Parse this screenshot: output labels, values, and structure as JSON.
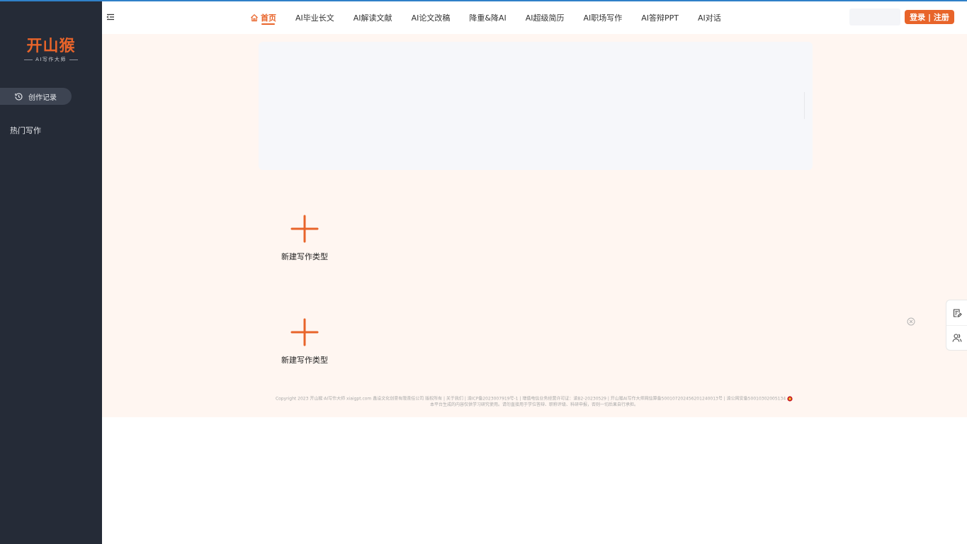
{
  "brand": {
    "logo_main": "开山猴",
    "logo_sub": "AI写作大师"
  },
  "sidebar": {
    "history_label": "创作记录",
    "hot_label": "热门写作"
  },
  "nav": {
    "items": [
      {
        "label": "首页",
        "active": true
      },
      {
        "label": "AI毕业长文"
      },
      {
        "label": "AI解读文献"
      },
      {
        "label": "AI论文改稿"
      },
      {
        "label": "降重&降AI"
      },
      {
        "label": "AI超级简历"
      },
      {
        "label": "AI职场写作"
      },
      {
        "label": "AI答辩PPT"
      },
      {
        "label": "AI对话"
      }
    ]
  },
  "header": {
    "auth_label": "登录 | 注册"
  },
  "cards": [
    {
      "label": "新建写作类型"
    },
    {
      "label": "新建写作类型"
    }
  ],
  "footer": {
    "line1": "Copyright 2023 开山猴·AI写作大师 xiaigpt.com 鑫设文化创意有限责任公司 版权所有 | 关于我们 | 渝ICP备2023007919号-1 | 增值电信业务经营许可证：渝B2-20230529 | 开山猴AI写作大师网信算备500107202456201240013号 | 渝公网安备50010302005134",
    "line2": "本平台生成的内容仅供学习研究使用。请勿直接用于学位答辩、职称评级、科研申报，否则一切后果自行承担。"
  },
  "colors": {
    "accent": "#e8642a",
    "sidebar_bg": "#252b37",
    "main_bg": "#fff6f1"
  },
  "icons": {
    "menu": "menu-fold-icon",
    "home": "home-icon",
    "history": "history-icon",
    "add": "plus-icon",
    "close": "close-circle-icon",
    "edit": "edit-doc-icon",
    "user": "users-icon",
    "police": "police-badge-icon"
  }
}
